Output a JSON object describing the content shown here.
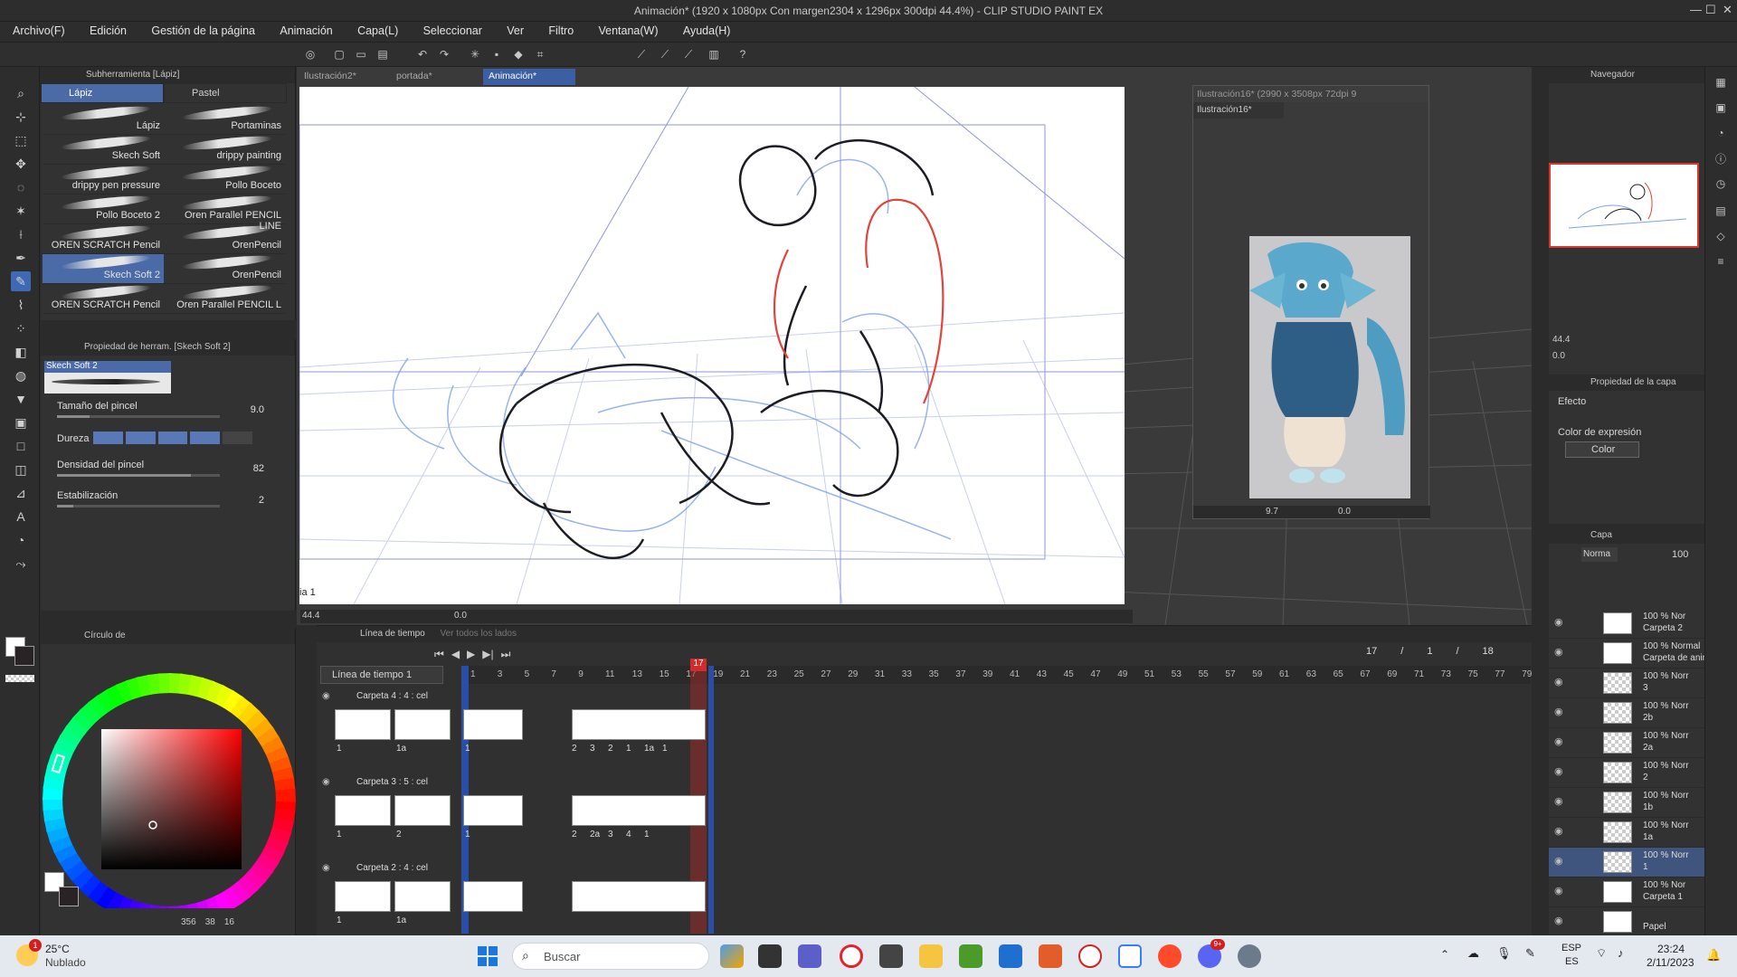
{
  "window": {
    "title": "Animación* (1920 x 1080px Con margen2304 x 1296px 300dpi 44.4%)  - CLIP STUDIO PAINT EX",
    "controls": [
      "—",
      "☐",
      "✕"
    ]
  },
  "menu": [
    "Archivo(F)",
    "Edición",
    "Gestión de la página",
    "Animación",
    "Capa(L)",
    "Seleccionar",
    "Ver",
    "Filtro",
    "Ventana(W)",
    "Ayuda(H)"
  ],
  "subtool": {
    "header": "Subherramienta [Lápiz]",
    "tabs": [
      "Lápiz",
      "Pastel"
    ],
    "brushes": [
      {
        "label": "Lápiz",
        "selected": false
      },
      {
        "label": "Portaminas",
        "selected": false
      },
      {
        "label": "Skech Soft",
        "selected": false
      },
      {
        "label": "drippy painting",
        "selected": false
      },
      {
        "label": "drippy pen pressure",
        "selected": false
      },
      {
        "label": "Pollo Boceto",
        "selected": false
      },
      {
        "label": "Pollo Boceto 2",
        "selected": false
      },
      {
        "label": "Oren Parallel PENCIL LINE",
        "selected": false
      },
      {
        "label": "OREN SCRATCH Pencil",
        "selected": false
      },
      {
        "label": "OrenPencil",
        "selected": false
      },
      {
        "label": "Skech Soft 2",
        "selected": true
      },
      {
        "label": "OrenPencil",
        "selected": false
      },
      {
        "label": "OREN SCRATCH Pencil",
        "selected": false
      },
      {
        "label": "Oren Parallel PENCIL L",
        "selected": false
      }
    ]
  },
  "toolprops": {
    "header": "Propiedad de herram. [Skech Soft 2]",
    "brush_name": "Skech Soft 2",
    "size_label": "Tamaño del pincel",
    "size_value": "9.0",
    "hardness_label": "Dureza",
    "hardness_level": 0.8,
    "density_label": "Densidad del pincel",
    "density_value": "82",
    "density_level": 0.82,
    "stab_label": "Estabilización",
    "stab_value": "2",
    "stab_level": 0.1
  },
  "colorpanel": {
    "header": "Círculo de",
    "readout": [
      "356",
      "38",
      "16"
    ],
    "main_color": "#2a2326",
    "sub_color": "#ffffff",
    "hue_marker_deg": 198
  },
  "canvas": {
    "tabs": [
      "Ilustración2*",
      "portada*",
      "Animación*"
    ],
    "active_tab": "Animación*",
    "corner_label": "ia 1",
    "zoom": "44.4",
    "angle": "0.0"
  },
  "reference": {
    "title": "Ilustración16* (2990 x 3508px 72dpi 9",
    "tab": "Ilustración16*",
    "zoom": "9.7",
    "angle": "0.0"
  },
  "navigator": {
    "header": "Navegador",
    "zoom": "44.4",
    "angle": "0.0"
  },
  "layer_property": {
    "header": "Propiedad de la capa",
    "effect_label": "Efecto",
    "expression_label": "Color de expresión",
    "expression_value": "Color"
  },
  "layers": {
    "header": "Capa",
    "blend": "Norma",
    "opacity": "100",
    "items": [
      {
        "line1": "100 % Nor",
        "line2": "Carpeta 2",
        "kind": "folder",
        "selected": false
      },
      {
        "line1": "100 % Normal",
        "line2": "Carpeta de animac",
        "kind": "anim",
        "selected": false
      },
      {
        "line1": "100 % Norr",
        "line2": "3",
        "kind": "cel",
        "selected": false
      },
      {
        "line1": "100 % Norr",
        "line2": "2b",
        "kind": "cel",
        "selected": false
      },
      {
        "line1": "100 % Norr",
        "line2": "2a",
        "kind": "cel",
        "selected": false
      },
      {
        "line1": "100 % Norr",
        "line2": "2",
        "kind": "cel",
        "selected": false
      },
      {
        "line1": "100 % Norr",
        "line2": "1b",
        "kind": "cel",
        "selected": false
      },
      {
        "line1": "100 % Norr",
        "line2": "1a",
        "kind": "cel",
        "selected": false
      },
      {
        "line1": "100 % Norr",
        "line2": "1",
        "kind": "cel",
        "selected": true
      },
      {
        "line1": "100 % Nor",
        "line2": "Carpeta 1",
        "kind": "folder",
        "selected": false
      },
      {
        "line1": "",
        "line2": "Papel",
        "kind": "paper",
        "selected": false
      }
    ]
  },
  "timeline": {
    "header": "Línea de tiempo",
    "header2": "Ver todos los lados",
    "selector": "Línea de tiempo 1",
    "current_frame": "17",
    "readout": [
      "17",
      "/",
      "1",
      "/",
      "18"
    ],
    "frame_numbers": [
      "1",
      "3",
      "5",
      "7",
      "9",
      "11",
      "13",
      "15",
      "17",
      "19",
      "21",
      "23",
      "25",
      "27",
      "29",
      "31",
      "33",
      "35",
      "37",
      "39",
      "41",
      "43",
      "45",
      "47",
      "49",
      "51",
      "53",
      "55",
      "57",
      "59",
      "61",
      "63",
      "65",
      "67",
      "69",
      "71",
      "73",
      "75",
      "77",
      "79"
    ],
    "tracks": [
      {
        "name": "Carpeta 4 : 4 : cel",
        "left_labels": [
          "1",
          "1a"
        ],
        "cel_labels": [
          "1",
          "2",
          "3",
          "2",
          "1",
          "1a",
          "1"
        ]
      },
      {
        "name": "Carpeta 3 : 5 : cel",
        "left_labels": [
          "1",
          "2"
        ],
        "cel_labels": [
          "1",
          "2",
          "2a",
          "3",
          "4",
          "1"
        ]
      },
      {
        "name": "Carpeta 2 : 4 : cel",
        "left_labels": [
          "1",
          "1a"
        ],
        "cel_labels": []
      }
    ]
  },
  "taskbar": {
    "weather_temp": "25°C",
    "weather_desc": "Nublado",
    "weather_badge": "1",
    "search_placeholder": "Buscar",
    "lang1": "ESP",
    "lang2": "ES",
    "time": "23:24",
    "date": "2/11/2023",
    "discord_badge": "9+"
  }
}
